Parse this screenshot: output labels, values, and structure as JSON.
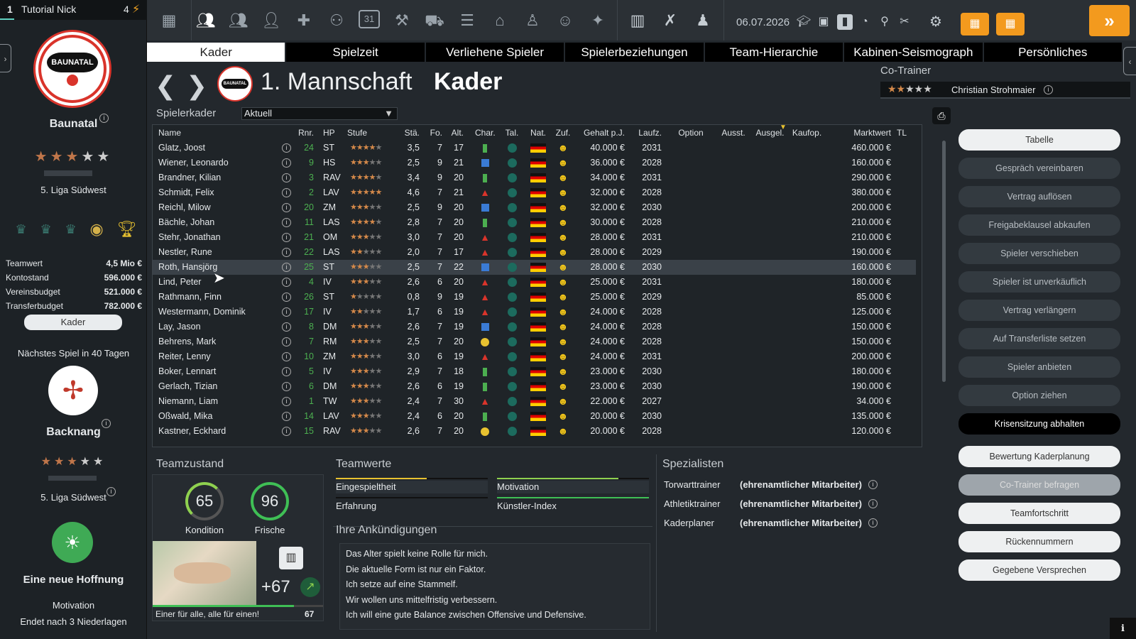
{
  "sidebar": {
    "slot": "1",
    "user": "Tutorial Nick",
    "energy": "4",
    "club": {
      "name": "Baunatal",
      "crest_text": "BAUNATAL",
      "stars_filled": 3,
      "stars_total": 5,
      "league": "5. Liga Südwest"
    },
    "finances": [
      {
        "label": "Teamwert",
        "value": "4,5 Mio €"
      },
      {
        "label": "Kontostand",
        "value": "596.000 €"
      },
      {
        "label": "Vereinsbudget",
        "value": "521.000 €"
      },
      {
        "label": "Transferbudget",
        "value": "782.000 €"
      }
    ],
    "kader_button": "Kader",
    "next_game": "Nächstes Spiel in 40 Tagen",
    "opponent": {
      "name": "Backnang",
      "stars_filled": 3,
      "stars_total": 5,
      "league": "5. Liga Südwest"
    },
    "status": {
      "title": "Eine neue Hoffnung",
      "sub": "Motivation",
      "note": "Endet nach 3 Niederlagen"
    }
  },
  "topbar": {
    "date": "06.07.2026",
    "calendar_day": "31"
  },
  "tabs": [
    "Kader",
    "Spielzeit",
    "Verliehene Spieler",
    "Spielerbeziehungen",
    "Team-Hierarchie",
    "Kabinen-Seismograph",
    "Persönliches"
  ],
  "header": {
    "team": "1. Mannschaft",
    "title": "Kader",
    "crest_text": "BAUNATAL"
  },
  "cotrainer": {
    "label": "Co-Trainer",
    "name": "Christian Strohmaier",
    "stars_filled": 2,
    "stars_total": 5
  },
  "filter": {
    "label": "Spielerkader",
    "value": "Aktuell"
  },
  "columns": [
    "Name",
    "Rnr.",
    "HP",
    "Stufe",
    "Stä.",
    "Fo.",
    "Alt.",
    "Char.",
    "Tal.",
    "Nat.",
    "Zuf.",
    "Gehalt p.J.",
    "Laufz.",
    "Option",
    "Ausst.",
    "Ausgel.",
    "Kaufop.",
    "Marktwert",
    "TL"
  ],
  "players": [
    {
      "name": "Glatz, Joost",
      "rnr": "24",
      "hp": "ST",
      "stars": 4,
      "sta": "3,5",
      "fo": "7",
      "alt": "17",
      "char": "green",
      "gehalt": "40.000 €",
      "laufz": "2031",
      "mw": "460.000 €"
    },
    {
      "name": "Wiener, Leonardo",
      "rnr": "9",
      "hp": "HS",
      "stars": 3,
      "sta": "2,5",
      "fo": "9",
      "alt": "21",
      "char": "blue",
      "gehalt": "36.000 €",
      "laufz": "2028",
      "mw": "160.000 €"
    },
    {
      "name": "Brandner, Kilian",
      "rnr": "3",
      "hp": "RAV",
      "stars": 4,
      "sta": "3,4",
      "fo": "9",
      "alt": "20",
      "char": "green",
      "gehalt": "34.000 €",
      "laufz": "2031",
      "mw": "290.000 €"
    },
    {
      "name": "Schmidt, Felix",
      "rnr": "2",
      "hp": "LAV",
      "stars": 5,
      "sta": "4,6",
      "fo": "7",
      "alt": "21",
      "char": "red",
      "gehalt": "32.000 €",
      "laufz": "2028",
      "mw": "380.000 €"
    },
    {
      "name": "Reichl, Milow",
      "rnr": "20",
      "hp": "ZM",
      "stars": 3,
      "sta": "2,5",
      "fo": "9",
      "alt": "20",
      "char": "blue",
      "gehalt": "32.000 €",
      "laufz": "2030",
      "mw": "200.000 €"
    },
    {
      "name": "Bächle, Johan",
      "rnr": "11",
      "hp": "LAS",
      "stars": 4,
      "sta": "2,8",
      "fo": "7",
      "alt": "20",
      "char": "green",
      "gehalt": "30.000 €",
      "laufz": "2028",
      "mw": "210.000 €"
    },
    {
      "name": "Stehr, Jonathan",
      "rnr": "21",
      "hp": "OM",
      "stars": 3,
      "sta": "3,0",
      "fo": "7",
      "alt": "20",
      "char": "red",
      "gehalt": "28.000 €",
      "laufz": "2031",
      "mw": "210.000 €"
    },
    {
      "name": "Nestler, Rune",
      "rnr": "22",
      "hp": "LAS",
      "stars": 2,
      "sta": "2,0",
      "fo": "7",
      "alt": "17",
      "char": "red",
      "gehalt": "28.000 €",
      "laufz": "2029",
      "mw": "190.000 €"
    },
    {
      "name": "Roth, Hansjörg",
      "rnr": "25",
      "hp": "ST",
      "stars": 3,
      "sta": "2,5",
      "fo": "7",
      "alt": "22",
      "char": "blue",
      "gehalt": "28.000 €",
      "laufz": "2030",
      "mw": "160.000 €"
    },
    {
      "name": "Lind, Peter",
      "rnr": "4",
      "hp": "IV",
      "stars": 3,
      "sta": "2,6",
      "fo": "6",
      "alt": "20",
      "char": "red",
      "gehalt": "25.000 €",
      "laufz": "2031",
      "mw": "180.000 €"
    },
    {
      "name": "Rathmann, Finn",
      "rnr": "26",
      "hp": "ST",
      "stars": 1,
      "sta": "0,8",
      "fo": "9",
      "alt": "19",
      "char": "red",
      "gehalt": "25.000 €",
      "laufz": "2029",
      "mw": "85.000 €"
    },
    {
      "name": "Westermann, Dominik",
      "rnr": "17",
      "hp": "IV",
      "stars": 2,
      "sta": "1,7",
      "fo": "6",
      "alt": "19",
      "char": "red",
      "gehalt": "24.000 €",
      "laufz": "2028",
      "mw": "125.000 €"
    },
    {
      "name": "Lay, Jason",
      "rnr": "8",
      "hp": "DM",
      "stars": 3,
      "sta": "2,6",
      "fo": "7",
      "alt": "19",
      "char": "blue",
      "gehalt": "24.000 €",
      "laufz": "2028",
      "mw": "150.000 €"
    },
    {
      "name": "Behrens, Mark",
      "rnr": "7",
      "hp": "RM",
      "stars": 3,
      "sta": "2,5",
      "fo": "7",
      "alt": "20",
      "char": "yellow",
      "gehalt": "24.000 €",
      "laufz": "2028",
      "mw": "150.000 €"
    },
    {
      "name": "Reiter, Lenny",
      "rnr": "10",
      "hp": "ZM",
      "stars": 3,
      "sta": "3,0",
      "fo": "6",
      "alt": "19",
      "char": "red",
      "gehalt": "24.000 €",
      "laufz": "2031",
      "mw": "200.000 €"
    },
    {
      "name": "Boker, Lennart",
      "rnr": "5",
      "hp": "IV",
      "stars": 3,
      "sta": "2,9",
      "fo": "7",
      "alt": "18",
      "char": "green",
      "gehalt": "23.000 €",
      "laufz": "2030",
      "mw": "180.000 €"
    },
    {
      "name": "Gerlach, Tizian",
      "rnr": "6",
      "hp": "DM",
      "stars": 3,
      "sta": "2,6",
      "fo": "6",
      "alt": "19",
      "char": "green",
      "gehalt": "23.000 €",
      "laufz": "2030",
      "mw": "190.000 €"
    },
    {
      "name": "Niemann, Liam",
      "rnr": "1",
      "hp": "TW",
      "stars": 3,
      "sta": "2,4",
      "fo": "7",
      "alt": "30",
      "char": "red",
      "gehalt": "22.000 €",
      "laufz": "2027",
      "mw": "34.000 €"
    },
    {
      "name": "Oßwald, Mika",
      "rnr": "14",
      "hp": "LAV",
      "stars": 3,
      "sta": "2,4",
      "fo": "6",
      "alt": "20",
      "char": "green",
      "gehalt": "20.000 €",
      "laufz": "2030",
      "mw": "135.000 €"
    },
    {
      "name": "Kastner, Eckhard",
      "rnr": "15",
      "hp": "RAV",
      "stars": 3,
      "sta": "2,6",
      "fo": "7",
      "alt": "20",
      "char": "yellow",
      "gehalt": "20.000 €",
      "laufz": "2028",
      "mw": "120.000 €"
    }
  ],
  "actions": [
    {
      "label": "Tabelle",
      "style": "light"
    },
    {
      "label": "Gespräch vereinbaren",
      "style": "dim"
    },
    {
      "label": "Vertrag auflösen",
      "style": "dim"
    },
    {
      "label": "Freigabeklausel abkaufen",
      "style": "dim"
    },
    {
      "label": "Spieler verschieben",
      "style": "dim"
    },
    {
      "label": "Spieler ist unverkäuflich",
      "style": "dim"
    },
    {
      "label": "Vertrag verlängern",
      "style": "dim"
    },
    {
      "label": "Auf Transferliste setzen",
      "style": "dim"
    },
    {
      "label": "Spieler anbieten",
      "style": "dim"
    },
    {
      "label": "Option ziehen",
      "style": "dim"
    },
    {
      "label": "Krisensitzung abhalten",
      "style": "dark"
    },
    {
      "label": "Bewertung Kaderplanung",
      "style": "light"
    },
    {
      "label": "Co-Trainer befragen",
      "style": "grey"
    },
    {
      "label": "Teamfortschritt",
      "style": "light"
    },
    {
      "label": "Rückennummern",
      "style": "light"
    },
    {
      "label": "Gegebene Versprechen",
      "style": "light"
    }
  ],
  "teamzustand": {
    "title": "Teamzustand",
    "kondition": {
      "label": "Kondition",
      "value": "65",
      "level": 0.65
    },
    "frische": {
      "label": "Frische",
      "value": "96",
      "level": 0.96
    },
    "delta": "+67",
    "motto": "Einer für alle, alle für einen!",
    "motto_value": "67"
  },
  "teamwerte": {
    "title": "Teamwerte",
    "items": [
      {
        "label": "Eingespieltheit",
        "level": 0.6,
        "color": "#e8c230"
      },
      {
        "label": "Motivation",
        "level": 0.8,
        "color": "#8fd14f"
      },
      {
        "label": "Erfahrung",
        "level": 0,
        "color": "#888"
      },
      {
        "label": "Künstler-Index",
        "level": 1.0,
        "color": "#4caf50"
      }
    ]
  },
  "ankuendigungen": {
    "title": "Ihre Ankündigungen",
    "lines": [
      "Das Alter spielt keine Rolle für mich.",
      "Die aktuelle Form ist nur ein Faktor.",
      "Ich setze auf eine Stammelf.",
      "Wir wollen uns mittelfristig verbessern.",
      "Ich will eine gute Balance zwischen Offensive und Defensive."
    ]
  },
  "spezialisten": {
    "title": "Spezialisten",
    "items": [
      {
        "role": "Torwarttrainer",
        "name": "(ehrenamtlicher Mitarbeiter)"
      },
      {
        "role": "Athletiktrainer",
        "name": "(ehrenamtlicher Mitarbeiter)"
      },
      {
        "role": "Kaderplaner",
        "name": "(ehrenamtlicher Mitarbeiter)"
      }
    ]
  },
  "colors": {
    "accent": "#f39a1e",
    "green": "#4caf50",
    "red": "#d9342b",
    "blue": "#3a7bd5",
    "yellow": "#e8c230"
  }
}
